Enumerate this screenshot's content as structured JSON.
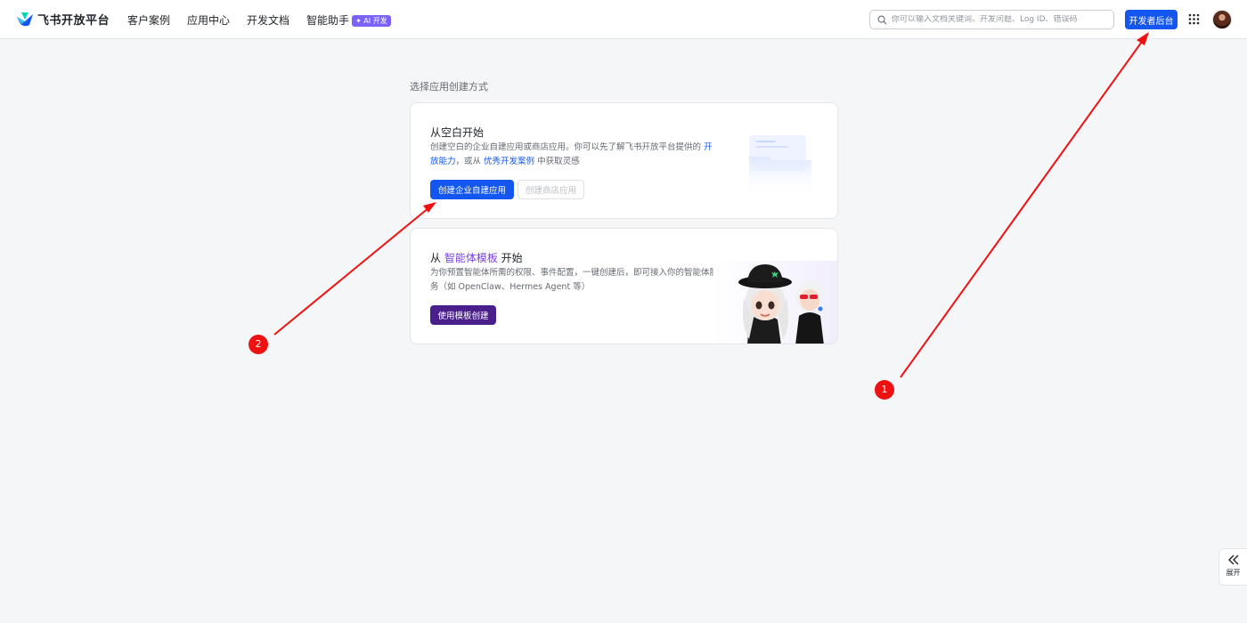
{
  "header": {
    "logo_text": "飞书开放平台",
    "nav": [
      {
        "label": "客户案例"
      },
      {
        "label": "应用中心"
      },
      {
        "label": "开发文档"
      },
      {
        "label": "智能助手",
        "badge": "✦ AI 开发"
      }
    ],
    "search_placeholder": "你可以输入文档关键词、开发问题、Log ID、错误码",
    "console_label": "开发者后台"
  },
  "main": {
    "section_title": "选择应用创建方式",
    "blank_card": {
      "title": "从空白开始",
      "desc_pre": "创建空白的企业自建应用或商店应用。你可以先了解飞书开放平台提供的 ",
      "desc_link1": "开放能力",
      "desc_mid": "，或从 ",
      "desc_link2": "优秀开发案例",
      "desc_post": " 中获取灵感",
      "primary_button": "创建企业自建应用",
      "secondary_button": "创建商店应用"
    },
    "template_card": {
      "title_pre": "从 ",
      "title_link": "智能体模板",
      "title_post": " 开始",
      "desc": "为你预置智能体所需的权限、事件配置，一键创建后，即可接入你的智能体服务（如 OpenClaw、Hermes Agent 等）",
      "button": "使用模板创建"
    }
  },
  "annotations": [
    {
      "label": "1"
    },
    {
      "label": "2"
    }
  ],
  "expand_tab": {
    "label": "展开"
  },
  "colors": {
    "primary": "#1456f0",
    "purple": "#4a1f8c",
    "annotation_red": "#ee1111",
    "background": "#f5f6f7"
  },
  "icons": {
    "logo": "feishu-logo-icon",
    "search": "search-icon",
    "apps": "grid-icon",
    "expand": "double-chevron-left-icon"
  }
}
